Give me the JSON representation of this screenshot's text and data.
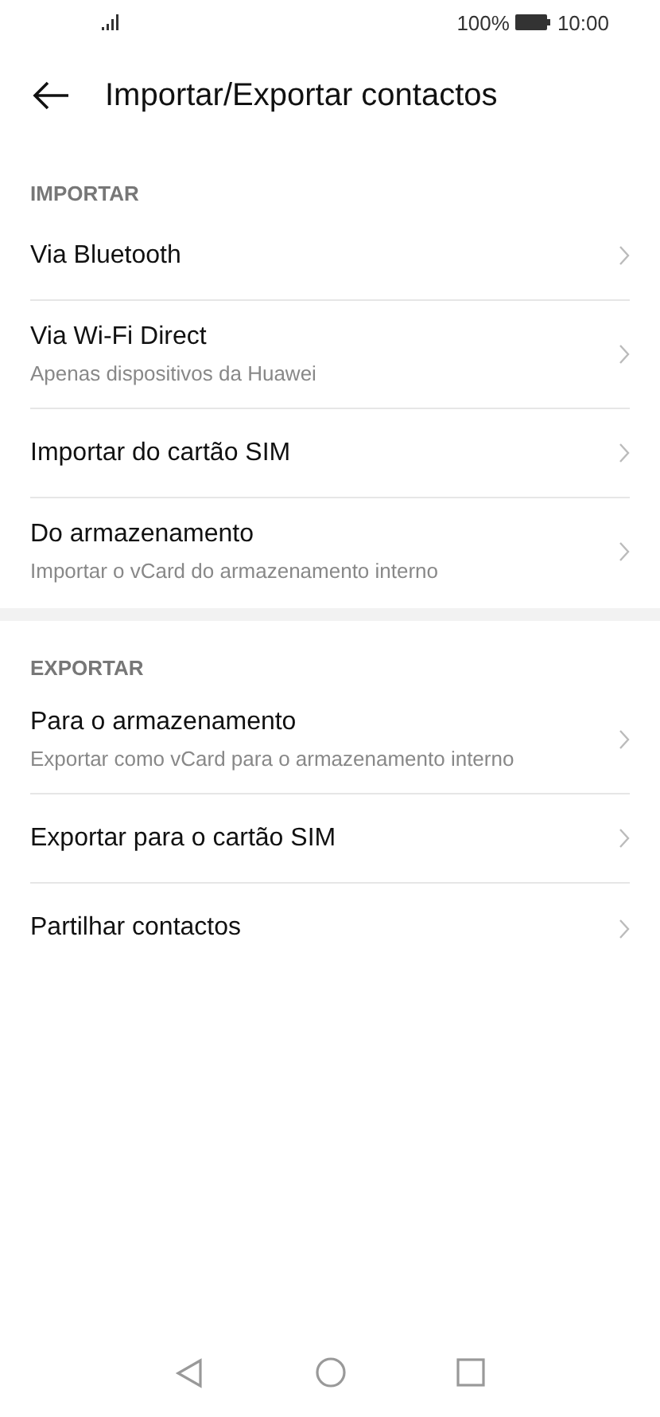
{
  "status_bar": {
    "battery": "100%",
    "time": "10:00"
  },
  "header": {
    "title": "Importar/Exportar contactos"
  },
  "sections": [
    {
      "heading": "IMPORTAR",
      "items": [
        {
          "title": "Via Bluetooth"
        },
        {
          "title": "Via Wi-Fi Direct",
          "subtitle": "Apenas dispositivos da Huawei"
        },
        {
          "title": "Importar do cartão SIM"
        },
        {
          "title": "Do armazenamento",
          "subtitle": "Importar o vCard do armazenamento interno"
        }
      ]
    },
    {
      "heading": "EXPORTAR",
      "items": [
        {
          "title": "Para o armazenamento",
          "subtitle": "Exportar como vCard para o armazenamento interno"
        },
        {
          "title": "Exportar para o cartão SIM"
        },
        {
          "title": "Partilhar contactos"
        }
      ]
    }
  ]
}
